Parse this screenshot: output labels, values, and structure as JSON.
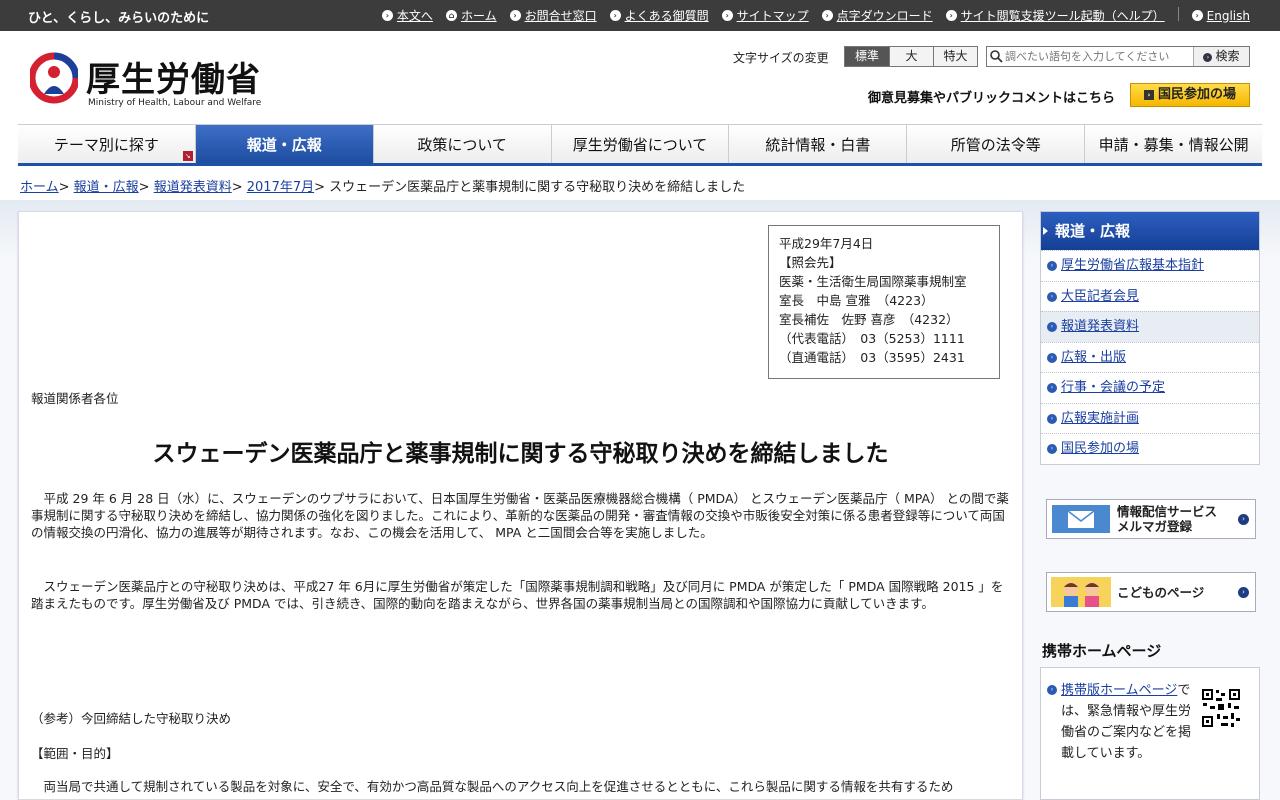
{
  "topbar": {
    "tagline": "ひと、くらし、みらいのために",
    "links": [
      "本文へ",
      "ホーム",
      "お問合せ窓口",
      "よくある御質問",
      "サイトマップ",
      "点字ダウンロード",
      "サイト閲覧支援ツール起動（ヘルプ）",
      "English"
    ]
  },
  "header": {
    "logo_text": "厚生労働省",
    "logo_en": "Ministry of Health, Labour and Welfare",
    "fontsize_label": "文字サイズの変更",
    "fontsize_options": [
      "標準",
      "大",
      "特大"
    ],
    "search_placeholder": "調べたい語句を入力してください",
    "search_button": "検索",
    "public_comment": "御意見募集やパブリックコメントはこちら",
    "kokumin_button": "国民参加の場"
  },
  "nav": [
    "テーマ別に探す",
    "報道・広報",
    "政策について",
    "厚生労働省について",
    "統計情報・白書",
    "所管の法令等",
    "申請・募集・情報公開"
  ],
  "breadcrumb": {
    "links": [
      "ホーム",
      "報道・広報",
      "報道発表資料",
      "2017年7月"
    ],
    "current": "スウェーデン医薬品庁と薬事規制に関する守秘取り決めを締結しました"
  },
  "article": {
    "contact": [
      "平成29年7月4日",
      "【照会先】",
      "医薬・生活衛生局国際薬事規制室",
      "室長　中島 宣雅　（4223）",
      "室長補佐　佐野 喜彦　（4232）",
      "（代表電話）　03（5253）1111",
      "（直通電話）　03（3595）2431"
    ],
    "recipients": "報道関係者各位",
    "title": "スウェーデン医薬品庁と薬事規制に関する守秘取り決めを締結しました",
    "para1": "平成 29 年 6 月 28 日（水）に、スウェーデンのウプサラにおいて、日本国厚生労働省・医薬品医療機器総合機構（ PMDA） とスウェーデン医薬品庁（ MPA） との間で薬事規制に関する守秘取り決めを締結し、協力関係の強化を図りました。これにより、革新的な医薬品の開発・審査情報の交換や市販後安全対策に係る患者登録等について両国の情報交換の円滑化、協力の進展等が期待されます。なお、この機会を活用して、 MPA と二国間会合等を実施しました。",
    "para2": "スウェーデン医薬品庁との守秘取り決めは、平成27 年 6月に厚生労働省が策定した「国際薬事規制調和戦略」及び同月に PMDA が策定した「 PMDA 国際戦略 2015 」を踏まえたものです。厚生労働省及び PMDA では、引き続き、国際的動向を踏まえながら、世界各国の薬事規制当局との国際調和や国際協力に貢献していきます。",
    "ref_label": "（参考）今回締結した守秘取り決め",
    "scope_label": "【範囲・目的】",
    "para3": "両当局で共通して規制されている製品を対象に、安全で、有効かつ高品質な製品へのアクセス向上を促進させるとともに、これら製品に関する情報を共有するため"
  },
  "sidebar": {
    "header": "報道・広報",
    "items": [
      "厚生労働省広報基本指針",
      "大臣記者会見",
      "報道発表資料",
      "広報・出版",
      "行事・会議の予定",
      "広報実施計画",
      "国民参加の場"
    ],
    "mail_banner": [
      "情報配信サービス",
      "メルマガ登録"
    ],
    "kids_banner": "こどものページ",
    "mobile_heading": "携帯ホームページ",
    "mobile_link": "携帯版ホームページ",
    "mobile_text": "では、緊急情報や厚生労働省のご案内などを掲載しています。"
  }
}
